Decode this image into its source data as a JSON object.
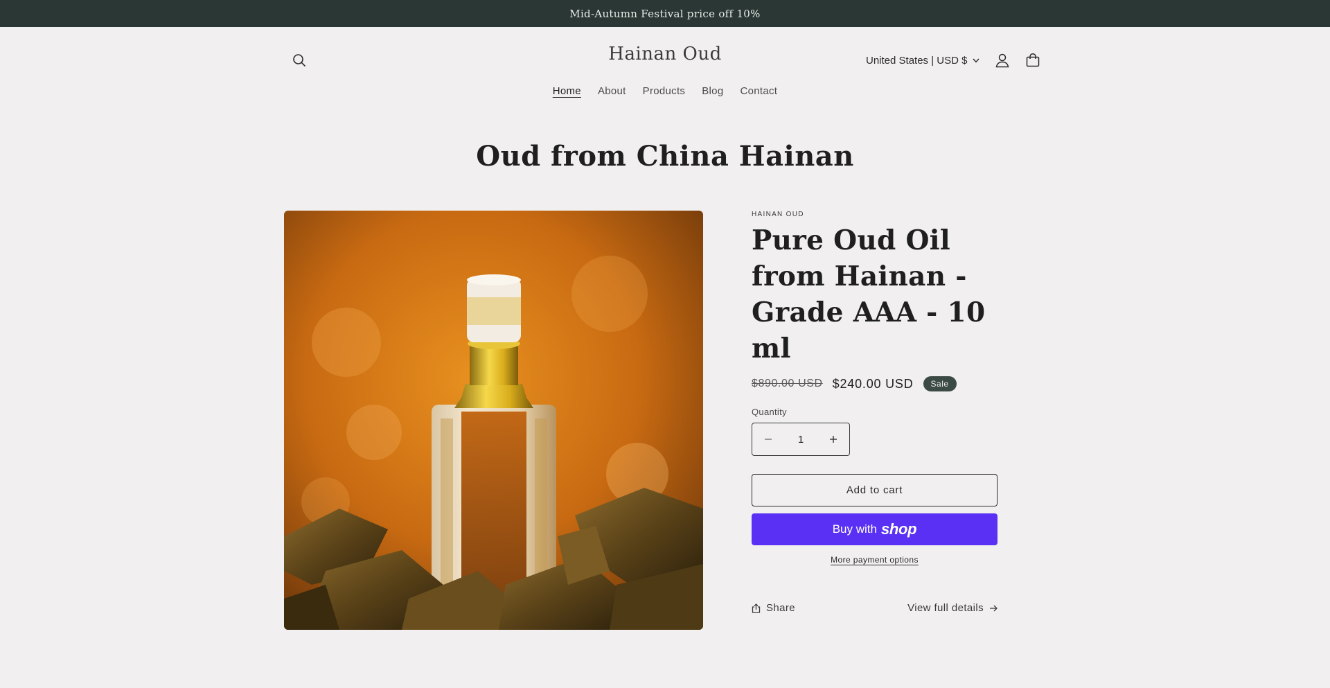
{
  "announcement": {
    "text": "Mid-Autumn Festival price off 10%"
  },
  "header": {
    "logo": "Hainan Oud",
    "currency": "United States | USD $",
    "nav": [
      {
        "label": "Home",
        "active": true
      },
      {
        "label": "About",
        "active": false
      },
      {
        "label": "Products",
        "active": false
      },
      {
        "label": "Blog",
        "active": false
      },
      {
        "label": "Contact",
        "active": false
      }
    ]
  },
  "section": {
    "title": "Oud from China Hainan"
  },
  "product": {
    "vendor": "HAINAN OUD",
    "title": "Pure Oud Oil from Hainan - Grade AAA - 10 ml",
    "price_old": "$890.00 USD",
    "price_new": "$240.00 USD",
    "badge": "Sale",
    "quantity_label": "Quantity",
    "quantity_value": "1",
    "add_to_cart": "Add to cart",
    "buy_with": "Buy with",
    "buy_brand": "shop",
    "more_payment": "More payment options",
    "share": "Share",
    "view_details": "View full details"
  },
  "colors": {
    "announce_bg": "#2b3734",
    "page_bg": "#f1eff0",
    "badge_bg": "#3c4a45",
    "shop_pay": "#5a31f4"
  },
  "icons": [
    "search-icon",
    "chevron-down-icon",
    "account-icon",
    "cart-icon",
    "minus-icon",
    "plus-icon",
    "share-icon",
    "arrow-right-icon"
  ]
}
